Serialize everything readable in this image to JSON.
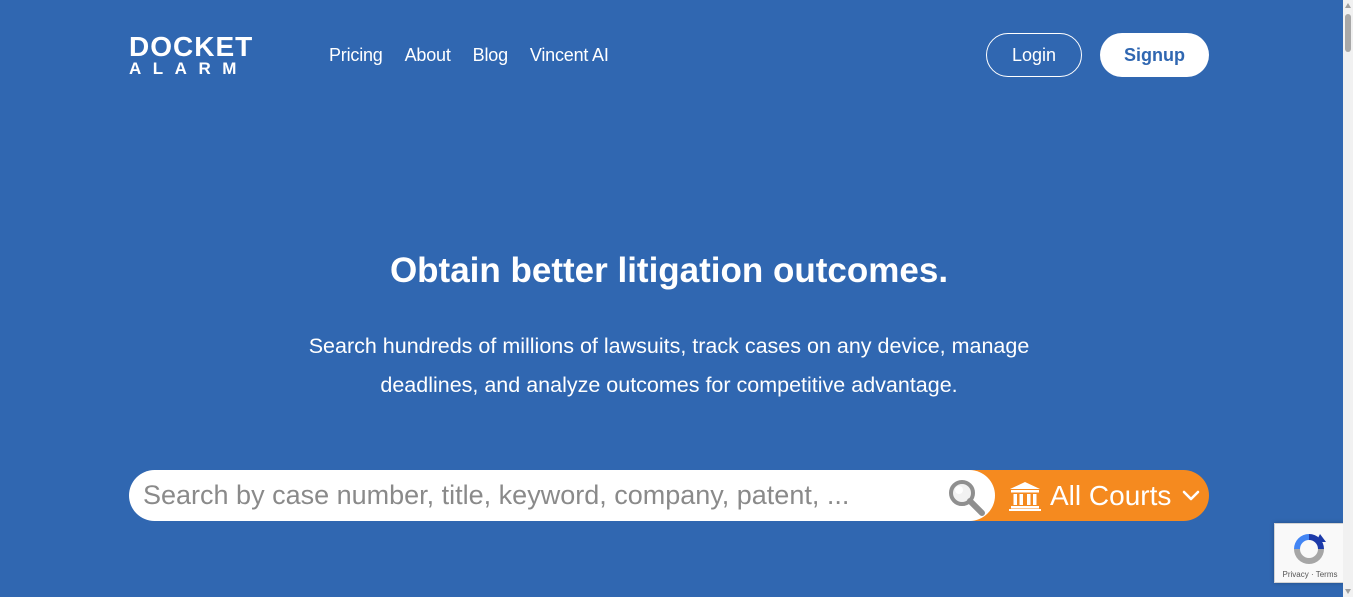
{
  "header": {
    "logo": {
      "line1": "DOCKET",
      "line2": "ALARM"
    },
    "nav": [
      {
        "label": "Pricing"
      },
      {
        "label": "About"
      },
      {
        "label": "Blog"
      },
      {
        "label": "Vincent AI"
      }
    ],
    "login_label": "Login",
    "signup_label": "Signup"
  },
  "hero": {
    "title": "Obtain better litigation outcomes.",
    "subtitle": "Search hundreds of millions of lawsuits, track cases on any device, manage deadlines, and analyze outcomes for competitive advantage."
  },
  "search": {
    "placeholder": "Search by case number, title, keyword, company, patent, ...",
    "value": "",
    "court_selector": {
      "selected": "All Courts",
      "icon": "bank-icon"
    },
    "search_icon": "magnifier-icon"
  },
  "recaptcha": {
    "privacy": "Privacy",
    "separator": "·",
    "terms": "Terms"
  },
  "colors": {
    "background": "#3067b1",
    "accent_orange": "#f58a1f",
    "white": "#ffffff"
  }
}
